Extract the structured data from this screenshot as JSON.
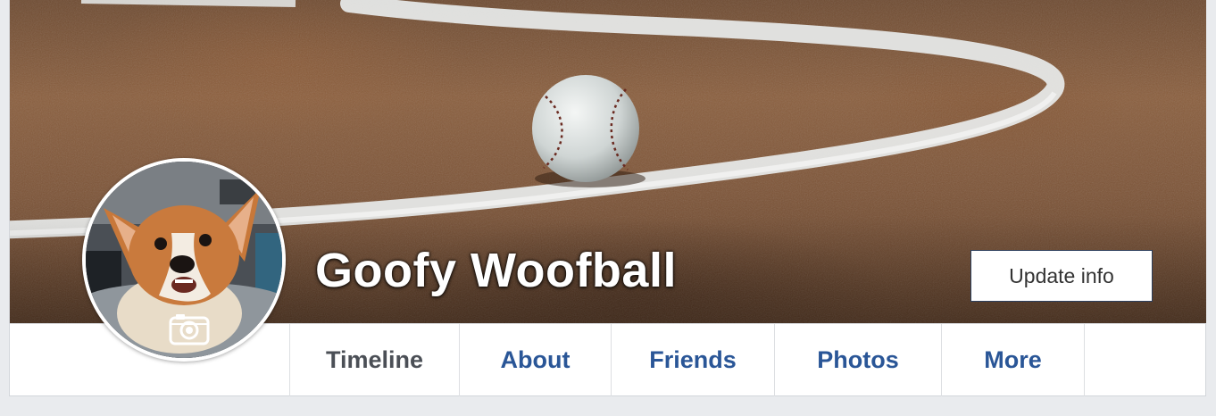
{
  "profile": {
    "name": "Goofy Woofball",
    "update_info_label": "Update info"
  },
  "nav": {
    "tabs": [
      {
        "label": "Timeline",
        "active": true
      },
      {
        "label": "About",
        "active": false
      },
      {
        "label": "Friends",
        "active": false
      },
      {
        "label": "Photos",
        "active": false
      },
      {
        "label": "More",
        "active": false
      }
    ]
  },
  "icons": {
    "avatar_overlay": "camera-icon"
  },
  "colors": {
    "link_blue": "#2a5697",
    "active_tab": "#4b4f56",
    "page_background": "#e9ebee"
  }
}
